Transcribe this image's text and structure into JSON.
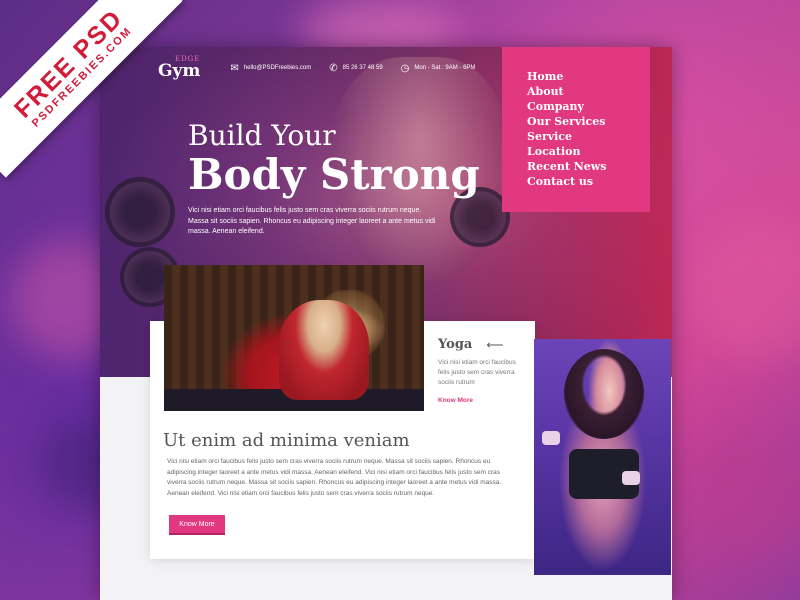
{
  "ribbon": {
    "line1": "FREE PSD",
    "line2": "PSDFREEBIES.COM"
  },
  "header": {
    "logo_small": "EDGE",
    "logo_big": "Gym",
    "email": "hello@PSDFreebies.com",
    "phone": "85 26 37 48 59",
    "hours": "Mon - Sat : 9AM - 6PM"
  },
  "nav": {
    "items": [
      "Home",
      "About",
      "Company",
      "Our Services",
      "Service",
      "Location",
      "Recent News",
      "Contact us"
    ]
  },
  "hero": {
    "title_line1": "Build Your",
    "title_line2": "Body Strong",
    "description": "Vici nisi etiam orci faucibus felis justo sem cras viverra sociis rutrum neque. Massa sit sociis sapien. Rhoncus eu adipiscing integer laoreet a ante metus vidi massa. Aenean eleifend."
  },
  "yoga": {
    "title": "Yoga",
    "text": "Vici nisi etiam orci faucibus felis justo sem cras viverra sociis rutrum",
    "link": "Know More"
  },
  "main": {
    "title": "Ut enim ad minima veniam",
    "text": "Vici nisi etiam orci faucibus felis justo sem cras viverra sociis rutrum neque. Massa sit sociis sapien. Rhoncus eu adipiscing integer laoreet a ante metus vidi massa. Aenean eleifend. Vici nisi etiam orci faucibus felis justo sem cras viverra sociis rutrum neque. Massa sit sociis sapien. Rhoncus eu adipiscing integer laoreet a ante metus vidi massa. Aenean eleifend. Vici nisi etiam orci faucibus felis justo sem cras viverra sociis rutrum neque.",
    "button": "Know More"
  },
  "colors": {
    "accent": "#e1387f",
    "ribbon_text": "#d11d3a"
  }
}
